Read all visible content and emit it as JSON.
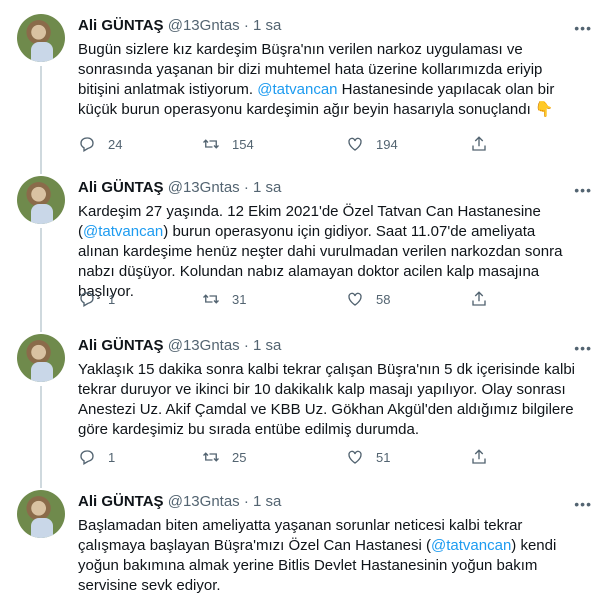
{
  "tweets": [
    {
      "author": "Ali GÜNTAŞ",
      "handle": "@13Gntas",
      "dot": "·",
      "time": "1 sa",
      "line1": "Bugün sizlere kız kardeşim Büşra'nın verilen narkoz uygulaması ve sonrasında yaşanan bir dizi muhtemel hata üzerine kollarımızda eriyip bitişini anlatmak istiyorum. ",
      "mention1": "@tatvancan",
      "line2": " Hastanesinde yapılacak olan bir küçük burun operasyonu kardeşimin ağır beyin hasarıyla sonuçlandı 👇",
      "replies": "24",
      "retweets": "154",
      "likes": "194"
    },
    {
      "author": "Ali GÜNTAŞ",
      "handle": "@13Gntas",
      "dot": "·",
      "time": "1 sa",
      "line1": "Kardeşim 27 yaşında. 12 Ekim 2021'de Özel Tatvan Can Hastanesine (",
      "mention1": "@tatvancan",
      "line2": ") burun operasyonu için gidiyor. Saat 11.07'de ameliyata alınan kardeşime henüz neşter dahi vurulmadan verilen narkozdan sonra nabzı düşüyor. Kolundan nabız alamayan doktor acilen kalp masajına başlıyor.",
      "replies": "1",
      "retweets": "31",
      "likes": "58"
    },
    {
      "author": "Ali GÜNTAŞ",
      "handle": "@13Gntas",
      "dot": "·",
      "time": "1 sa",
      "line1": "Yaklaşık 15 dakika sonra kalbi tekrar çalışan Büşra'nın 5 dk içerisinde kalbi tekrar duruyor ve ikinci bir 10 dakikalık kalp masajı yapılıyor. Olay sonrası Anestezi Uz. Akif Çamdal ve KBB Uz. Gökhan Akgül'den aldığımız bilgilere göre kardeşimiz bu sırada entübe edilmiş durumda.",
      "replies": "1",
      "retweets": "25",
      "likes": "51"
    },
    {
      "author": "Ali GÜNTAŞ",
      "handle": "@13Gntas",
      "dot": "·",
      "time": "1 sa",
      "line1": "Başlamadan biten ameliyatta yaşanan sorunlar neticesi kalbi tekrar çalışmaya başlayan Büşra'mızı Özel Can Hastanesi (",
      "mention1": "@tatvancan",
      "line2": ") kendi yoğun bakımına almak yerine Bitlis Devlet Hastanesinin yoğun bakım servisine sevk ediyor."
    }
  ],
  "icons": {
    "reply": "reply-icon",
    "retweet": "retweet-icon",
    "like": "heart-icon",
    "share": "share-icon",
    "more": "more-icon"
  },
  "colors": {
    "mention": "#1d9bf0",
    "secondary": "#536471",
    "text": "#0f1419"
  }
}
